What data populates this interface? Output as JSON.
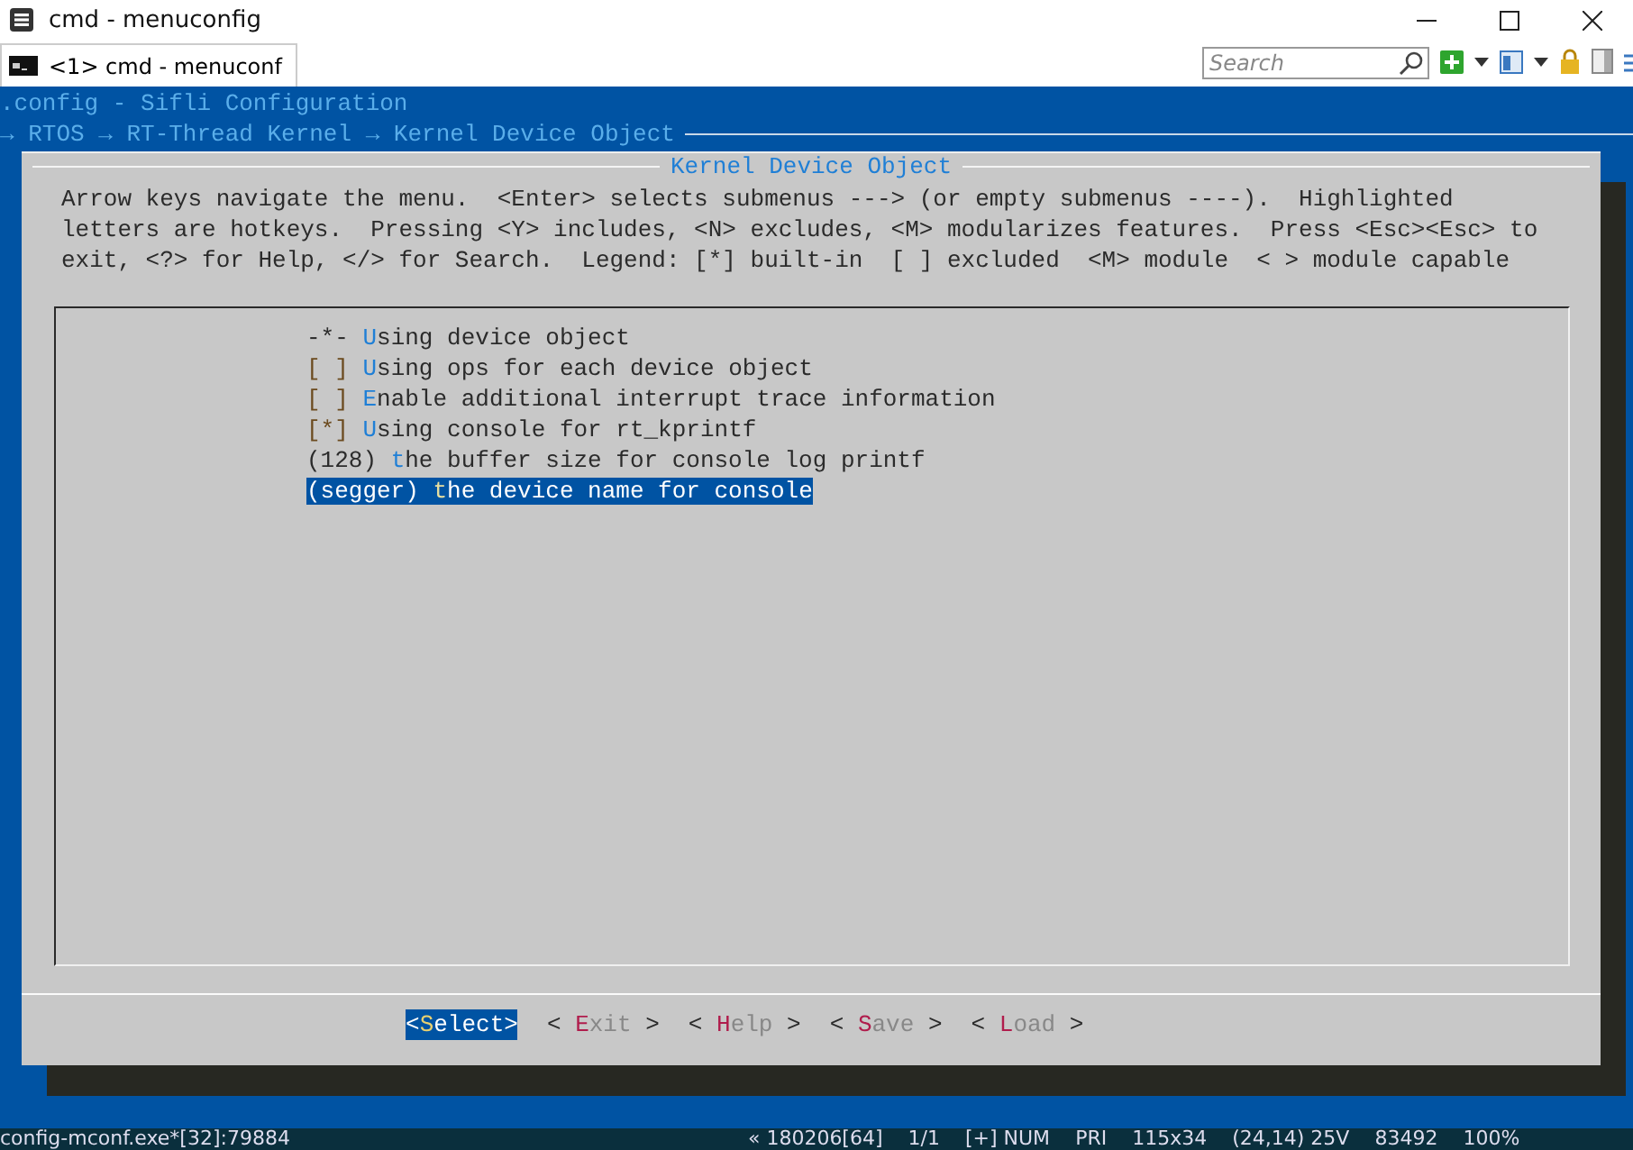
{
  "window": {
    "title": "cmd - menuconfig"
  },
  "tabs": [
    {
      "label": "<1> cmd - menuconf",
      "selected": true
    }
  ],
  "search": {
    "placeholder": "Search"
  },
  "terminal": {
    "header": ".config - Sifli Configuration",
    "breadcrumb": "→ RTOS → RT-Thread Kernel → Kernel Device Object"
  },
  "dialog": {
    "title": "Kernel Device Object",
    "help": [
      "Arrow keys navigate the menu.  <Enter> selects submenus ---> (or empty submenus ----).  Highlighted",
      "letters are hotkeys.  Pressing <Y> includes, <N> excludes, <M> modularizes features.  Press <Esc><Esc> to",
      "exit, <?> for Help, </> for Search.  Legend: [*] built-in  [ ] excluded  <M> module  < > module capable"
    ],
    "items": [
      {
        "kind": "fixed",
        "prefix": "-*- ",
        "hotkey": "U",
        "rest": "sing device object",
        "selected": false
      },
      {
        "kind": "bool",
        "prefix": "[ ] ",
        "hotkey": "U",
        "rest": "sing ops for each device object",
        "selected": false
      },
      {
        "kind": "bool",
        "prefix": "[ ] ",
        "hotkey": "E",
        "rest": "nable additional interrupt trace information",
        "selected": false
      },
      {
        "kind": "bool",
        "prefix": "[*] ",
        "hotkey": "U",
        "rest": "sing console for rt_kprintf",
        "selected": false
      },
      {
        "kind": "value",
        "prefix": "(128) ",
        "hotkey": "t",
        "rest": "he buffer size for console log printf",
        "selected": false
      },
      {
        "kind": "value",
        "prefix": "(segger) ",
        "hotkey": "t",
        "rest": "he device name for console",
        "selected": true
      }
    ],
    "buttons": [
      {
        "left": "<",
        "hotkey": "S",
        "rest": "elect",
        "right": ">",
        "selected": true
      },
      {
        "left": "<",
        "hotkey": "E",
        "rest": "xit",
        "right": ">",
        "selected": false
      },
      {
        "left": "<",
        "hotkey": "H",
        "rest": "elp",
        "right": ">",
        "selected": false
      },
      {
        "left": "<",
        "hotkey": "S",
        "rest": "ave",
        "right": ">",
        "selected": false
      },
      {
        "left": "<",
        "hotkey": "L",
        "rest": "oad",
        "right": ">",
        "selected": false
      }
    ]
  },
  "status_bar": [
    "config-mconf.exe*[32]:79884",
    "« 180206[64]",
    "1/1",
    "[+] NUM",
    "PRI",
    "115x34",
    "(24,14) 25V",
    "83492",
    "100%"
  ]
}
